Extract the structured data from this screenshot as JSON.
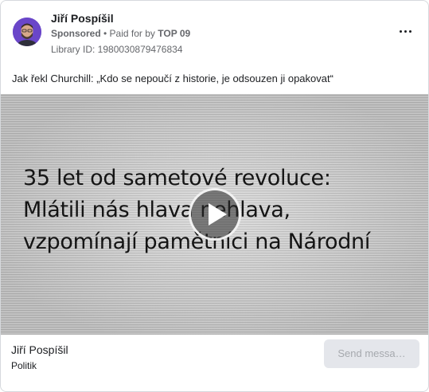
{
  "ad": {
    "advertiser": "Jiří Pospíšil",
    "sponsored": "Sponsored",
    "paid_for_by_prefix": " • Paid for by ",
    "paid_for_by": "TOP 09",
    "library_id": "Library ID: 1980030879476834",
    "body_text": "Jak řekl Churchill: „Kdo se nepoučí z historie, je odsouzen ji opakovat“",
    "video": {
      "headline_lines": [
        "35 let od sametové revoluce:",
        "Mlátili nás hlava nehlava,",
        "vzpomínají pamětníci na Národní"
      ]
    },
    "footer": {
      "name": "Jiří Pospíšil",
      "category": "Politik",
      "cta_label": "Send messa…"
    }
  },
  "colors": {
    "avatar_bg": "#6a46c9",
    "secondary_text": "#65676b",
    "button_bg": "#e4e6eb"
  },
  "icons": {
    "more": "more-horizontal-icon",
    "play": "play-icon",
    "avatar": "avatar-portrait"
  }
}
